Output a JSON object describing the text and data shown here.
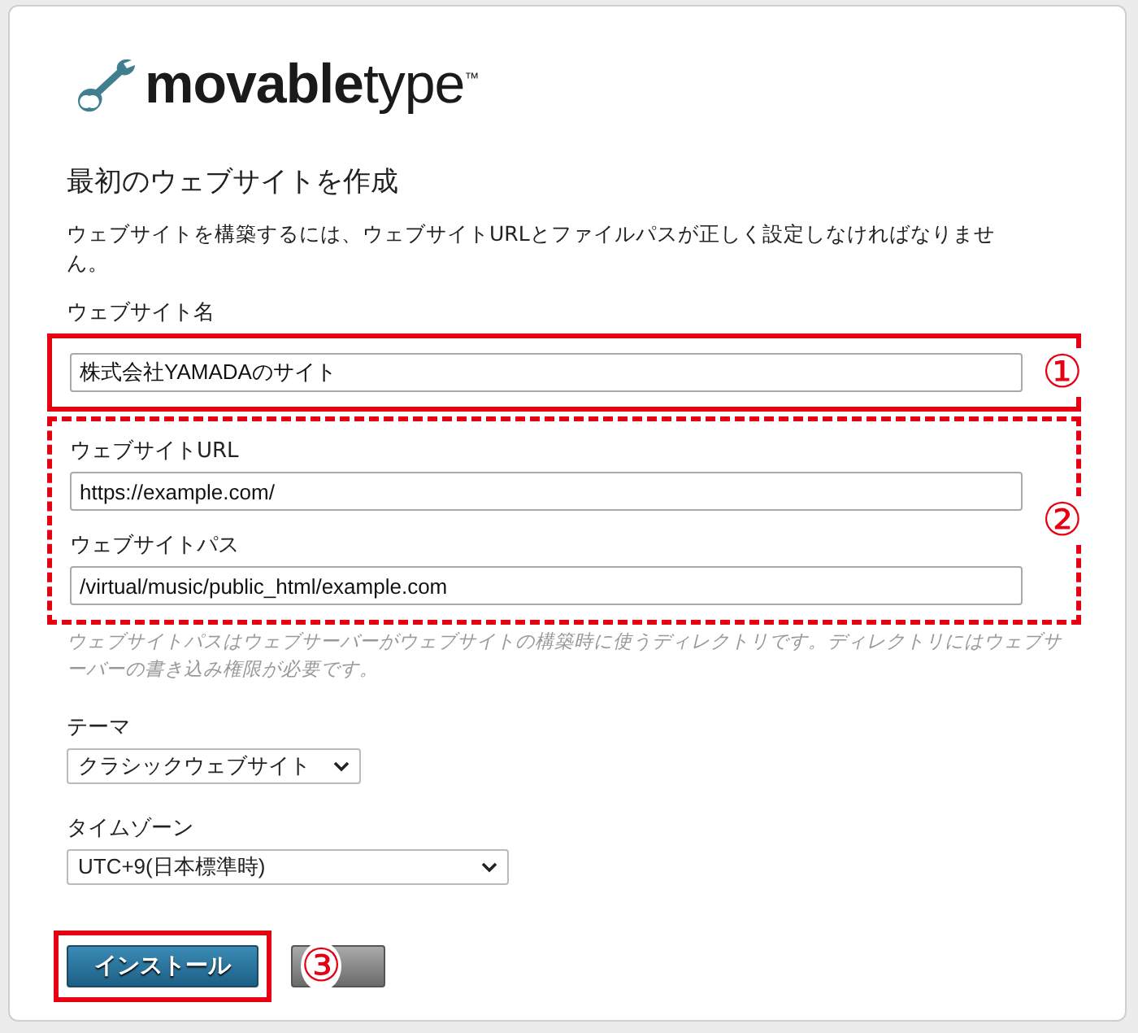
{
  "logo": {
    "text": "**movable**type$^{™}$"
  },
  "heading": "最初のウェブサイトを作成",
  "intro": "ウェブサイトを構築するには、ウェブサイトURLとファイルパスが正しく設定しなければなりません。",
  "name_section": {
    "callout": {
      "label": "①",
      "kind": "solid"
    },
    "fields": [
      {
        "label": "ウェブサイト名",
        "value": "株式会社YAMADAのサイト"
      }
    ]
  },
  "location_section": {
    "callout": {
      "label": "②",
      "kind": "dashed"
    },
    "fields": [
      {
        "label": "ウェブサイトURL",
        "value": "https://example.com/"
      },
      {
        "label": "ウェブサイトパス",
        "value": "/virtual/music/public_html/example.com"
      }
    ]
  },
  "hint": "ウェブサイトパスはウェブサーバーがウェブサイトの構築時に使うディレクトリです。ディレクトリにはウェブサーバーの書き込み権限が必要です。",
  "selects": [
    {
      "label": "テーマ",
      "value": "クラシックウェブサイト"
    },
    {
      "label": "タイムゾーン",
      "value": "UTC+9(日本標準時)"
    }
  ],
  "buttons_section": {
    "callout": {
      "label": "③",
      "kind": "solid"
    },
    "primary": "インストール"
  }
}
